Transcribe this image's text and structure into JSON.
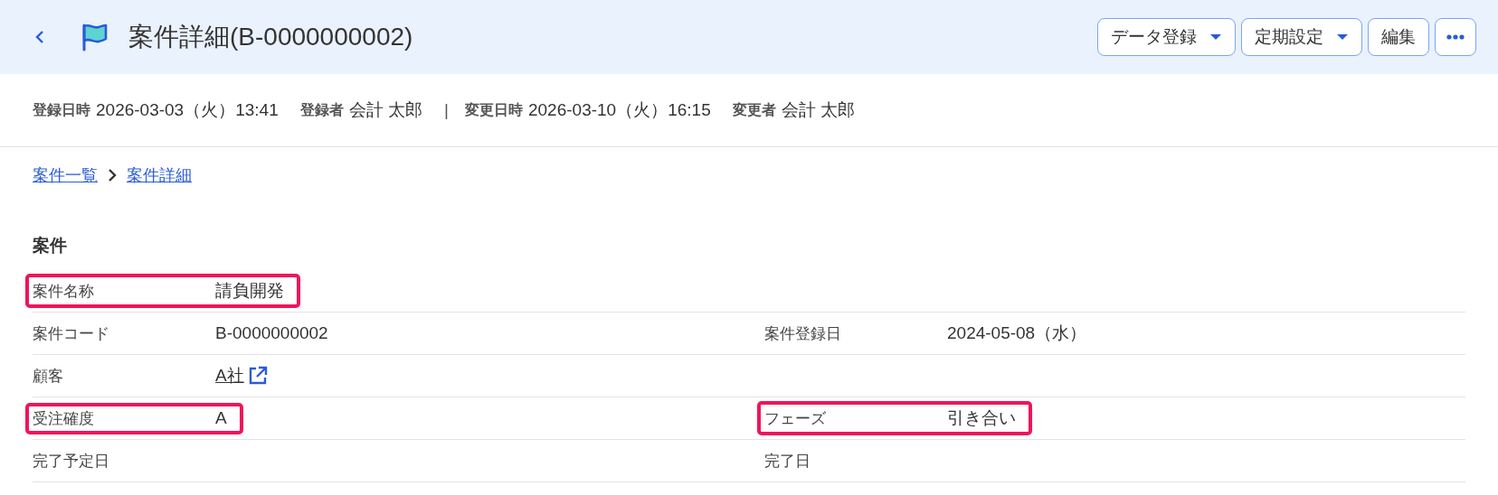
{
  "header": {
    "title": "案件詳細(B-0000000002)",
    "buttons": [
      {
        "label": "データ登録",
        "kind": "dropdown"
      },
      {
        "label": "定期設定",
        "kind": "dropdown"
      },
      {
        "label": "編集",
        "kind": "plain"
      },
      {
        "kind": "more"
      }
    ]
  },
  "meta": [
    {
      "label": "登録日時",
      "value": "2026-03-03（火）13:41"
    },
    {
      "label": "登録者",
      "value": "会計 太郎"
    },
    {
      "label": "変更日時",
      "value": "2026-03-10（火）16:15"
    },
    {
      "label": "変更者",
      "value": "会計 太郎"
    }
  ],
  "meta_separator": "|",
  "breadcrumb": [
    "案件一覧",
    "案件詳細"
  ],
  "section": {
    "title": "案件",
    "rows": [
      [
        {
          "label": "案件名称",
          "value": "請負開発",
          "kind": "text",
          "highlighted": true
        }
      ],
      [
        {
          "label": "案件コード",
          "value": "B-0000000002",
          "kind": "text",
          "highlighted": false
        },
        {
          "label": "案件登録日",
          "value": "2024-05-08（水）",
          "kind": "text",
          "highlighted": false
        }
      ],
      [
        {
          "label": "顧客",
          "value": "A社",
          "kind": "link",
          "highlighted": false
        },
        {
          "kind": "blank"
        }
      ],
      [
        {
          "label": "受注確度",
          "value": "A",
          "kind": "text",
          "highlighted": true
        },
        {
          "label": "フェーズ",
          "value": "引き合い",
          "kind": "text",
          "highlighted": true
        }
      ],
      [
        {
          "label": "完了予定日",
          "kind": "empty",
          "highlighted": false
        },
        {
          "label": "完了日",
          "kind": "empty",
          "highlighted": false
        }
      ]
    ]
  }
}
